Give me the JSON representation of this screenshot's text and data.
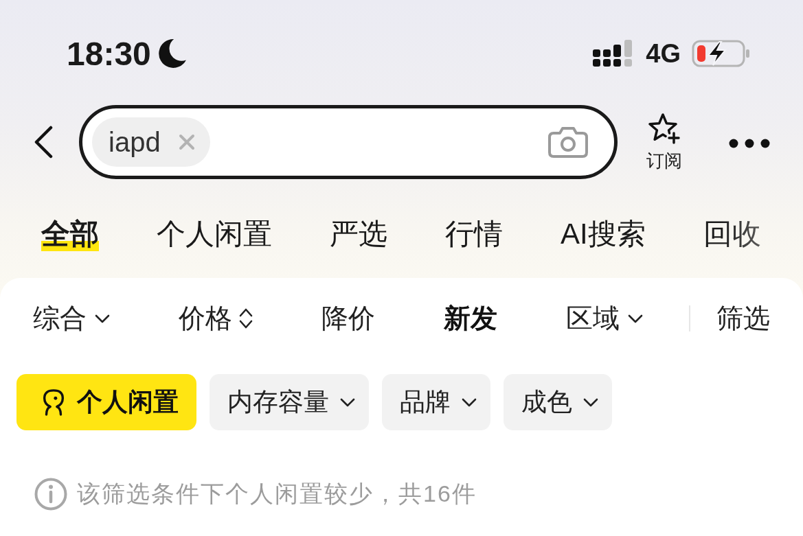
{
  "status_bar": {
    "time": "18:30",
    "network": "4G"
  },
  "search": {
    "query_tag": "iapd"
  },
  "subscribe": {
    "label": "订阅"
  },
  "tabs": [
    {
      "label": "全部",
      "selected": true
    },
    {
      "label": "个人闲置",
      "selected": false
    },
    {
      "label": "严选",
      "selected": false
    },
    {
      "label": "行情",
      "selected": false
    },
    {
      "label": "AI搜索",
      "selected": false
    },
    {
      "label": "回收",
      "selected": false
    }
  ],
  "sort_options": [
    {
      "label": "综合",
      "kind": "dropdown",
      "selected": false
    },
    {
      "label": "价格",
      "kind": "sort",
      "selected": false
    },
    {
      "label": "降价",
      "kind": "plain",
      "selected": false
    },
    {
      "label": "新发",
      "kind": "plain",
      "selected": true
    },
    {
      "label": "区域",
      "kind": "dropdown",
      "selected": false
    }
  ],
  "filter": {
    "label": "筛选"
  },
  "chips": [
    {
      "label": "个人闲置",
      "kind": "toggle",
      "selected": true
    },
    {
      "label": "内存容量",
      "kind": "dropdown",
      "selected": false
    },
    {
      "label": "品牌",
      "kind": "dropdown",
      "selected": false
    },
    {
      "label": "成色",
      "kind": "dropdown",
      "selected": false
    }
  ],
  "notice": {
    "text": "该筛选条件下个人闲置较少，共16件"
  }
}
